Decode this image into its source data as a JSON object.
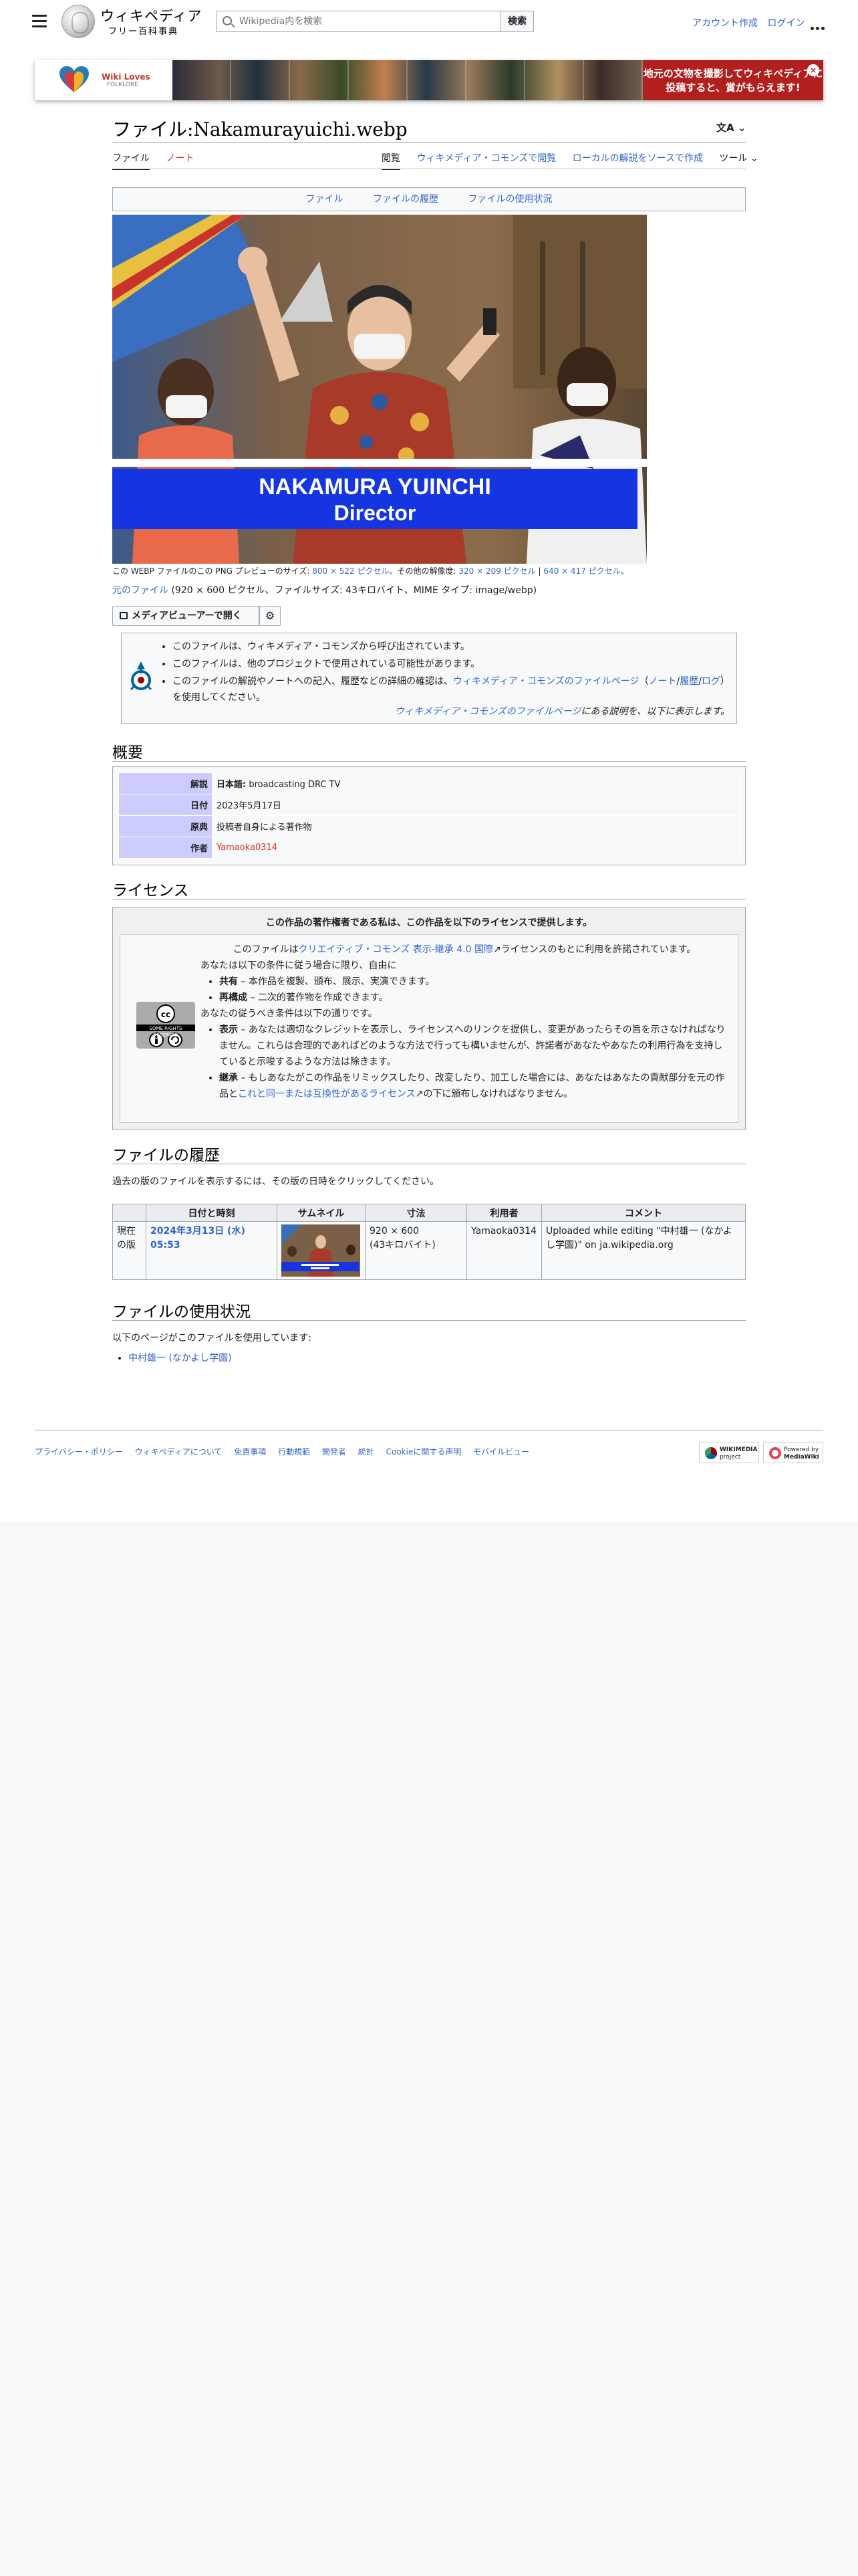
{
  "header": {
    "wordmark": "ウィキペディア",
    "tagline": "フリー百科事典",
    "search_placeholder": "Wikipedia内を検索",
    "search_button": "検索",
    "create_account": "アカウント作成",
    "login": "ログイン"
  },
  "banner": {
    "brand_line1": "Wiki Loves",
    "brand_line2": "FOLKLORE",
    "cta": "地元の文物を撮影してウィキペディアに投稿すると、賞がもらえます!",
    "close": "×"
  },
  "page": {
    "title": "ファイル:Nakamurayuichi.webp",
    "lang_icon": "文A",
    "tabs_left": [
      "ファイル",
      "ノート"
    ],
    "tabs_right": [
      "閲覧",
      "ウィキメディア・コモンズで閲覧",
      "ローカルの解説をソースで作成",
      "ツール"
    ]
  },
  "file_toc": [
    "ファイル",
    "ファイルの履歴",
    "ファイルの使用状況"
  ],
  "image": {
    "caption_top": "NAKAMURA YUINCHI",
    "caption_bottom": "Director"
  },
  "file_meta": {
    "preview_prefix": "この WEBP ファイルのこの PNG プレビューのサイズ: ",
    "preview_size": "800 × 522 ピクセル",
    "other_res_prefix": "。その他の解像度: ",
    "other_res_1": "320 × 209 ピクセル",
    "other_res_sep": " | ",
    "other_res_2": "640 × 417 ピクセル",
    "end": "。",
    "original_link": "元のファイル",
    "original_info": " (920 × 600 ピクセル、ファイルサイズ: 43キロバイト、MIME タイプ: image/webp)"
  },
  "media_viewer_button": "メディアビューアーで開く",
  "commons_notice": {
    "item1": "このファイルは、ウィキメディア・コモンズから呼び出されています。",
    "item2": "このファイルは、他のプロジェクトで使用されている可能性があります。",
    "item3_pre": "このファイルの解説やノートへの記入、履歴などの詳細の確認は、",
    "item3_link1": "ウィキメディア・コモンズのファイルページ",
    "item3_paren_open": "（",
    "item3_link2": "ノート",
    "item3_slash": "/",
    "item3_link3": "履歴",
    "item3_slash2": "/",
    "item3_link4": "ログ",
    "item3_post": "）を使用してください。",
    "footer_link": "ウィキメディア・コモンズのファイルページ",
    "footer_post": "にある説明を、以下に表示します。"
  },
  "summary": {
    "heading": "概要",
    "rows": [
      {
        "key": "解説",
        "value_label": "日本語:",
        "value": " broadcasting DRC TV"
      },
      {
        "key": "日付",
        "value_label": "",
        "value": "2023年5月17日"
      },
      {
        "key": "原典",
        "value_label": "",
        "value": "投稿者自身による著作物"
      },
      {
        "key": "作者",
        "value_label": "",
        "value": "Yamaoka0314"
      }
    ]
  },
  "license": {
    "heading": "ライセンス",
    "box_title": "この作品の著作権者である私は、この作品を以下のライセンスで提供します。",
    "cc_logo_text": "SOME RIGHTS RESERVED",
    "line1_pre": "このファイルは",
    "line1_link": "クリエイティブ・コモンズ 表示-継承 4.0 国際",
    "line1_post": "ライセンスのもとに利用を許諾されています。",
    "line2": "あなたは以下の条件に従う場合に限り、自由に",
    "free1_label": "共有",
    "free1_text": " – 本作品を複製、頒布、展示、実演できます。",
    "free2_label": "再構成",
    "free2_text": " – 二次的著作物を作成できます。",
    "line3": "あなたの従うべき条件は以下の通りです。",
    "cond1_label": "表示",
    "cond1_text": " – あなたは適切なクレジットを表示し、ライセンスへのリンクを提供し、変更があったらその旨を示さなければなりません。これらは合理的であればどのような方法で行っても構いませんが、許諾者があなたやあなたの利用行為を支持していると示唆するような方法は除きます。",
    "cond2_label": "継承",
    "cond2_text_pre": " – もしあなたがこの作品をリミックスしたり、改変したり、加工した場合には、あなたはあなたの貢献部分を元の作品と",
    "cond2_link": "これと同一または互換性があるライセンス",
    "cond2_text_post": "の下に頒布しなければなりません。"
  },
  "history": {
    "heading": "ファイルの履歴",
    "desc": "過去の版のファイルを表示するには、その版の日時をクリックしてください。",
    "columns": [
      "",
      "日付と時刻",
      "サムネイル",
      "寸法",
      "利用者",
      "コメント"
    ],
    "row": {
      "status": "現在の版",
      "datetime": "2024年3月13日 (水) 05:53",
      "dimensions": "920 × 600",
      "size": "(43キロバイト)",
      "user": "Yamaoka0314",
      "comment": "Uploaded while editing \"中村雄一 (なかよし学園)\" on ja.wikipedia.org"
    }
  },
  "usage": {
    "heading": "ファイルの使用状況",
    "desc": "以下のページがこのファイルを使用しています:",
    "pages": [
      "中村雄一 (なかよし学園)"
    ]
  },
  "footer": {
    "links": [
      "プライバシー・ポリシー",
      "ウィキペディアについて",
      "免責事項",
      "行動規範",
      "開発者",
      "統計",
      "Cookieに関する声明",
      "モバイルビュー"
    ],
    "wmf_badge_1": "WIKIMEDIA",
    "wmf_badge_2": "project",
    "mw_badge_1": "Powered by",
    "mw_badge_2": "MediaWiki"
  }
}
